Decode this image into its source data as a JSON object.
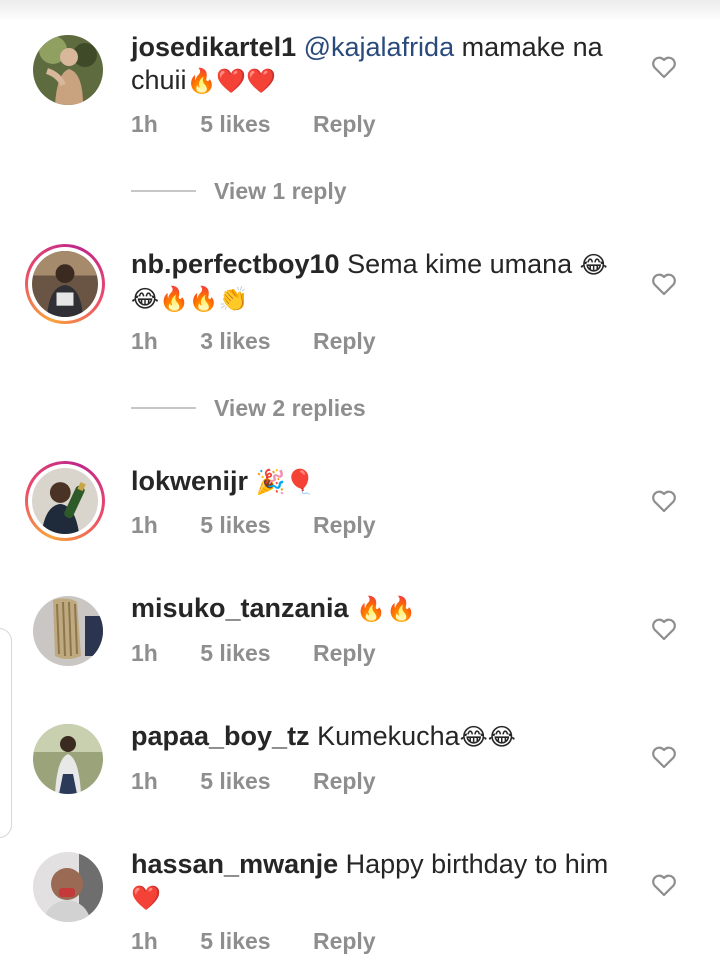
{
  "comments": [
    {
      "username": "josedikartel1",
      "mention": "@kajalafrida",
      "body": " mamake na chuii",
      "emojis": "🔥❤️❤️",
      "time": "1h",
      "likes": "5 likes",
      "reply": "Reply",
      "view_replies": "View 1 reply"
    },
    {
      "username": "nb.perfectboy10",
      "body": " Sema kime umana ",
      "emojis": "😂😂🔥🔥👏",
      "time": "1h",
      "likes": "3 likes",
      "reply": "Reply",
      "view_replies": "View 2 replies"
    },
    {
      "username": "lokwenijr",
      "body": " ",
      "emojis": "🎉🎈",
      "time": "1h",
      "likes": "5 likes",
      "reply": "Reply"
    },
    {
      "username": "misuko_tanzania",
      "body": " ",
      "emojis": "🔥🔥",
      "time": "1h",
      "likes": "5 likes",
      "reply": "Reply"
    },
    {
      "username": "papaa_boy_tz",
      "body": " Kumekucha",
      "emojis": "😂😂",
      "time": "1h",
      "likes": "5 likes",
      "reply": "Reply"
    },
    {
      "username": "hassan_mwanje",
      "body": " Happy birthday to him ",
      "emojis": "❤️",
      "time": "1h",
      "likes": "5 likes",
      "reply": "Reply"
    }
  ],
  "colors": {
    "text": "#262626",
    "meta": "#8e8e8e",
    "mention": "#2a4a7c",
    "story_ring_start": "#f9a33b",
    "story_ring_end": "#c0268b"
  },
  "icons": {
    "like": "heart-outline-icon"
  }
}
